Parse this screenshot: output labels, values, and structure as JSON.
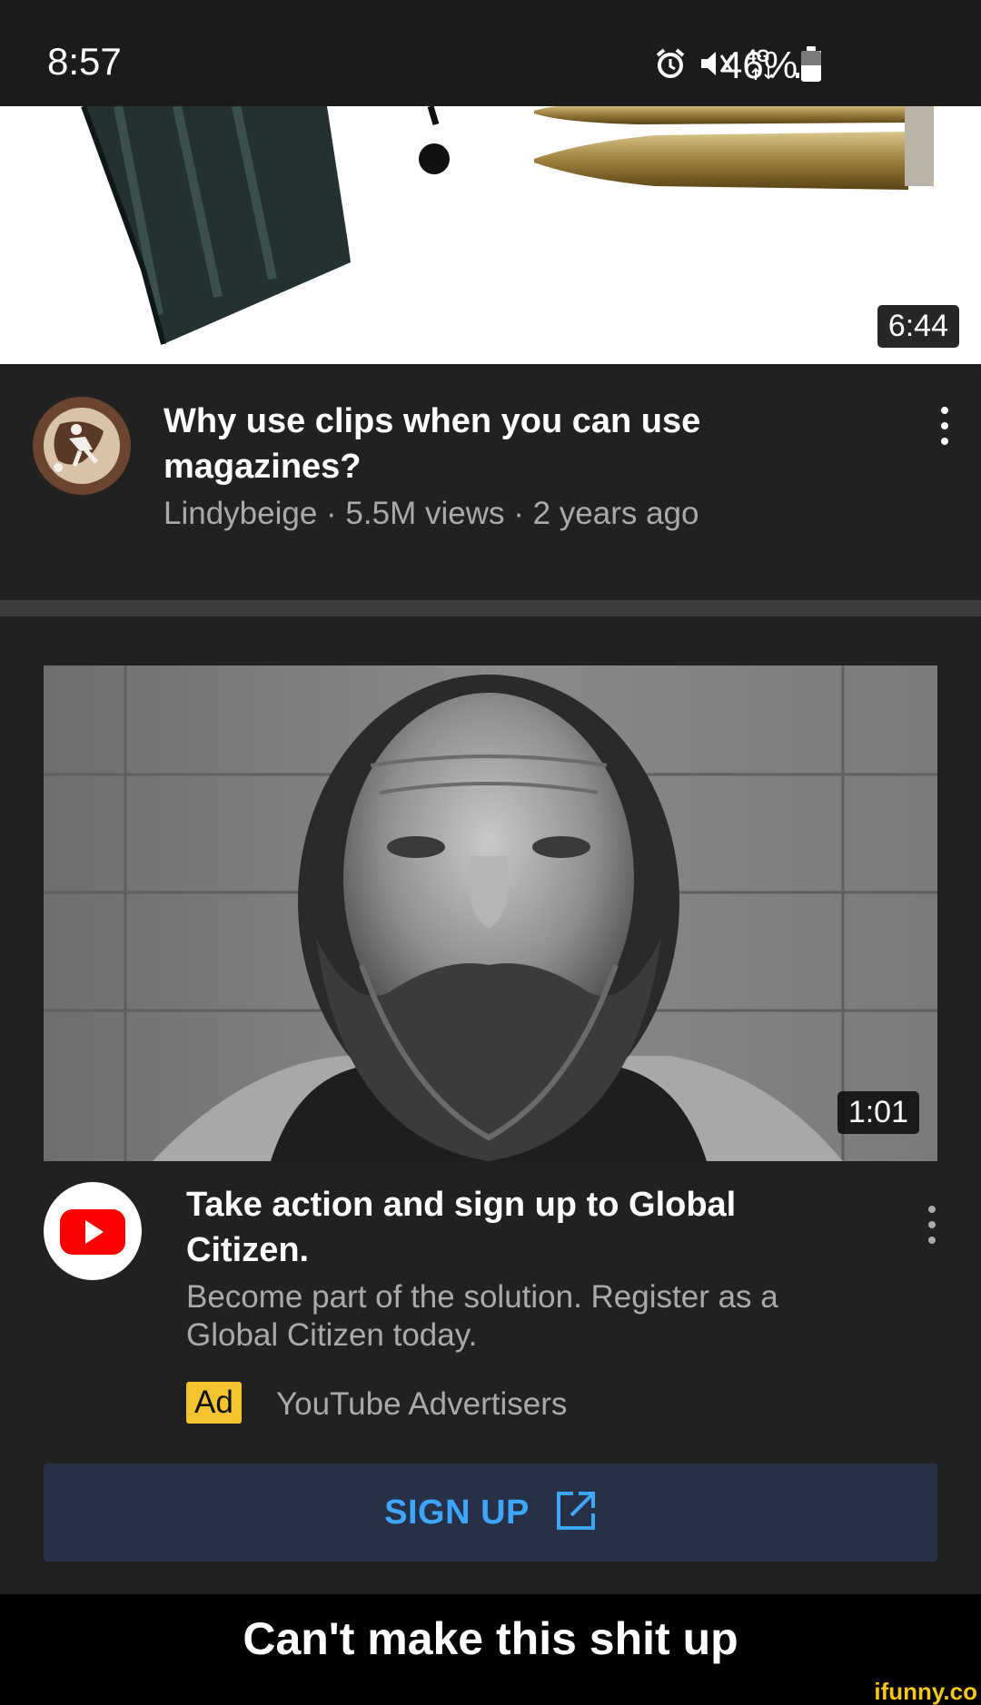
{
  "status_bar": {
    "time": "8:57",
    "network": "4G",
    "battery": "46%",
    "icons": [
      "alarm-icon",
      "mute-vibrate-icon",
      "4g-data-icon",
      "signal-icon",
      "battery-icon"
    ]
  },
  "video1": {
    "duration": "6:44",
    "title": "Why use clips when you can use magazines?",
    "meta": "Lindybeige · 5.5M views · 2 years ago"
  },
  "ad": {
    "duration": "1:01",
    "title": "Take action and sign up to Global Citizen.",
    "description": "Become part of the solution. Register as a Global Citizen today.",
    "badge": "Ad",
    "advertiser": "YouTube Advertisers",
    "cta_label": "SIGN UP"
  },
  "meme": {
    "caption": "Can't make this shit up",
    "watermark": "ifunny.co"
  },
  "colors": {
    "background": "#212121",
    "accent_link": "#3ea6ff",
    "ad_badge": "#f4c430",
    "youtube_red": "#ff0000"
  }
}
